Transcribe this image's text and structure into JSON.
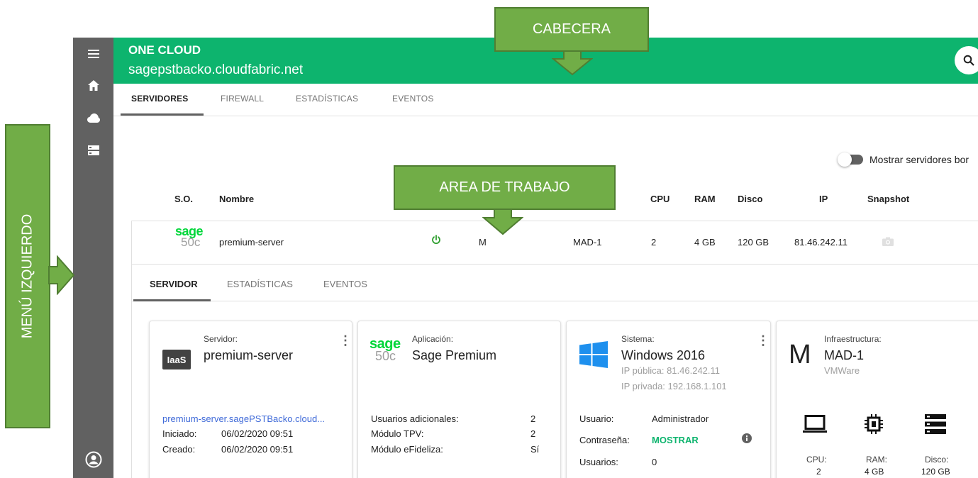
{
  "header": {
    "brand": "ONE CLOUD",
    "host": "sagepstbacko.cloudfabric.net"
  },
  "tabs": [
    {
      "label": "SERVIDORES",
      "active": true
    },
    {
      "label": "FIREWALL"
    },
    {
      "label": "ESTADÍSTICAS"
    },
    {
      "label": "EVENTOS"
    }
  ],
  "toggle_label": "Mostrar servidores bor",
  "table": {
    "headers": [
      "S.O.",
      "Nombre",
      "CPU",
      "RAM",
      "Disco",
      "IP",
      "Snapshot"
    ],
    "row": {
      "logo_sage": "sage",
      "logo_version": "50c",
      "name": "premium-server",
      "size": "M",
      "location": "MAD-1",
      "cpu": "2",
      "ram": "4 GB",
      "disk": "120 GB",
      "ip": "81.46.242.11"
    }
  },
  "detail_tabs": [
    {
      "label": "SERVIDOR",
      "active": true
    },
    {
      "label": "ESTADÍSTICAS"
    },
    {
      "label": "EVENTOS"
    }
  ],
  "cards": {
    "server": {
      "label": "Servidor:",
      "title": "premium-server",
      "badge": "IaaS",
      "link": "premium-server.sagePSTBacko.cloud...",
      "started_label": "Iniciado:",
      "started_value": "06/02/2020 09:51",
      "created_label": "Creado:",
      "created_value": "06/02/2020 09:51"
    },
    "app": {
      "label": "Aplicación:",
      "title": "Sage Premium",
      "logo_sage": "sage",
      "logo_version": "50c",
      "rows": [
        {
          "k": "Usuarios adicionales:",
          "v": "2"
        },
        {
          "k": "Módulo TPV:",
          "v": "2"
        },
        {
          "k": "Módulo eFideliza:",
          "v": "Sí"
        }
      ]
    },
    "system": {
      "label": "Sistema:",
      "title": "Windows 2016",
      "public_ip": "IP pública: 81.46.242.11",
      "private_ip": "IP privada: 192.168.1.101",
      "user_label": "Usuario:",
      "user_value": "Administrador",
      "password_label": "Contraseña:",
      "password_action": "MOSTRAR",
      "users_label": "Usuarios:",
      "users_value": "0"
    },
    "infra": {
      "letter": "M",
      "label": "Infraestructura:",
      "title": "MAD-1",
      "subtitle": "VMWare",
      "cpu_label": "CPU:",
      "cpu_value": "2",
      "ram_label": "RAM:",
      "ram_value": "4 GB",
      "disk_label": "Disco:",
      "disk_value": "120 GB"
    }
  },
  "annotations": {
    "header": "CABECERA",
    "workarea": "AREA DE TRABAJO",
    "leftmenu": "MENÚ IZQUIERDO"
  },
  "colors": {
    "header_green": "#0db46e",
    "sidebar_gray": "#616161",
    "annotation_green": "#71ad47",
    "power_green": "#2e9e2e",
    "sage_green": "#00d639"
  }
}
